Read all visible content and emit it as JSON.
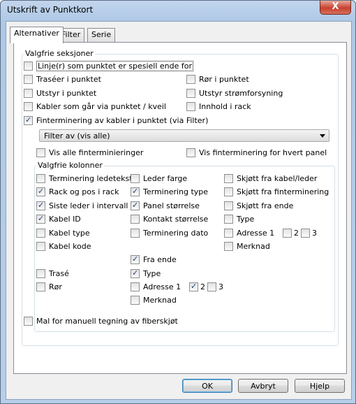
{
  "window": {
    "title": "Utskrift av Punktkort",
    "close_glyph": "X"
  },
  "tabs": [
    "Alternativer",
    "Filter",
    "Serie"
  ],
  "sections": {
    "label": "Valgfrie seksjoner",
    "items": [
      {
        "label": "Linje(r) som punktet er spesiell ende for",
        "checked": false
      },
      {
        "label": "Traséer i punktet",
        "checked": false
      },
      {
        "label": "Rør i punktet",
        "checked": false
      },
      {
        "label": "Utstyr i punktet",
        "checked": false
      },
      {
        "label": "Utstyr strømforsyning",
        "checked": false
      },
      {
        "label": "Kabler som går via punktet / kveil",
        "checked": false
      },
      {
        "label": "Innhold i rack",
        "checked": false
      },
      {
        "label": "Finterminering av kabler i punktet (via Filter)",
        "checked": true
      }
    ],
    "filter_select": "Filter av (vis alle)",
    "vis_alle": {
      "label": "Vis alle finterminieringer",
      "checked": false
    },
    "vis_hvert": {
      "label": "Vis finterminering for hvert panel",
      "checked": false
    }
  },
  "columns": {
    "label": "Valgfrie kolonner",
    "items": [
      {
        "label": "Terminering ledetekst",
        "checked": false
      },
      {
        "label": "Rack og pos i rack",
        "checked": true
      },
      {
        "label": "Siste leder i intervall",
        "checked": true
      },
      {
        "label": "Kabel ID",
        "checked": true
      },
      {
        "label": "Kabel type",
        "checked": false
      },
      {
        "label": "Kabel kode",
        "checked": false
      },
      {
        "label": "Leder farge",
        "checked": false
      },
      {
        "label": "Terminering type",
        "checked": true
      },
      {
        "label": "Panel størrelse",
        "checked": true
      },
      {
        "label": "Kontakt størrelse",
        "checked": false
      },
      {
        "label": "Terminering dato",
        "checked": false
      },
      {
        "label": "Skjøtt fra kabel/leder",
        "checked": false
      },
      {
        "label": "Skjøtt fra finterminering",
        "checked": false
      },
      {
        "label": "Skjøtt fra ende",
        "checked": false
      },
      {
        "label": "Type",
        "checked": false
      },
      {
        "label": "Adresse 1",
        "checked": false
      },
      {
        "label": "2",
        "checked": false
      },
      {
        "label": "3",
        "checked": false
      },
      {
        "label": "Merknad",
        "checked": false
      },
      {
        "label": "Fra ende",
        "checked": true
      },
      {
        "label": "Type",
        "checked": true
      },
      {
        "label": "Adresse 1",
        "checked": false
      },
      {
        "label": "2",
        "checked": true
      },
      {
        "label": "3",
        "checked": false
      },
      {
        "label": "Merknad",
        "checked": false
      },
      {
        "label": "Trasé",
        "checked": false
      },
      {
        "label": "Rør",
        "checked": false
      }
    ]
  },
  "mal": {
    "label": "Mal for manuell tegning av fiberskjøt",
    "checked": false
  },
  "buttons": {
    "ok": "OK",
    "cancel": "Avbryt",
    "help": "Hjelp"
  }
}
